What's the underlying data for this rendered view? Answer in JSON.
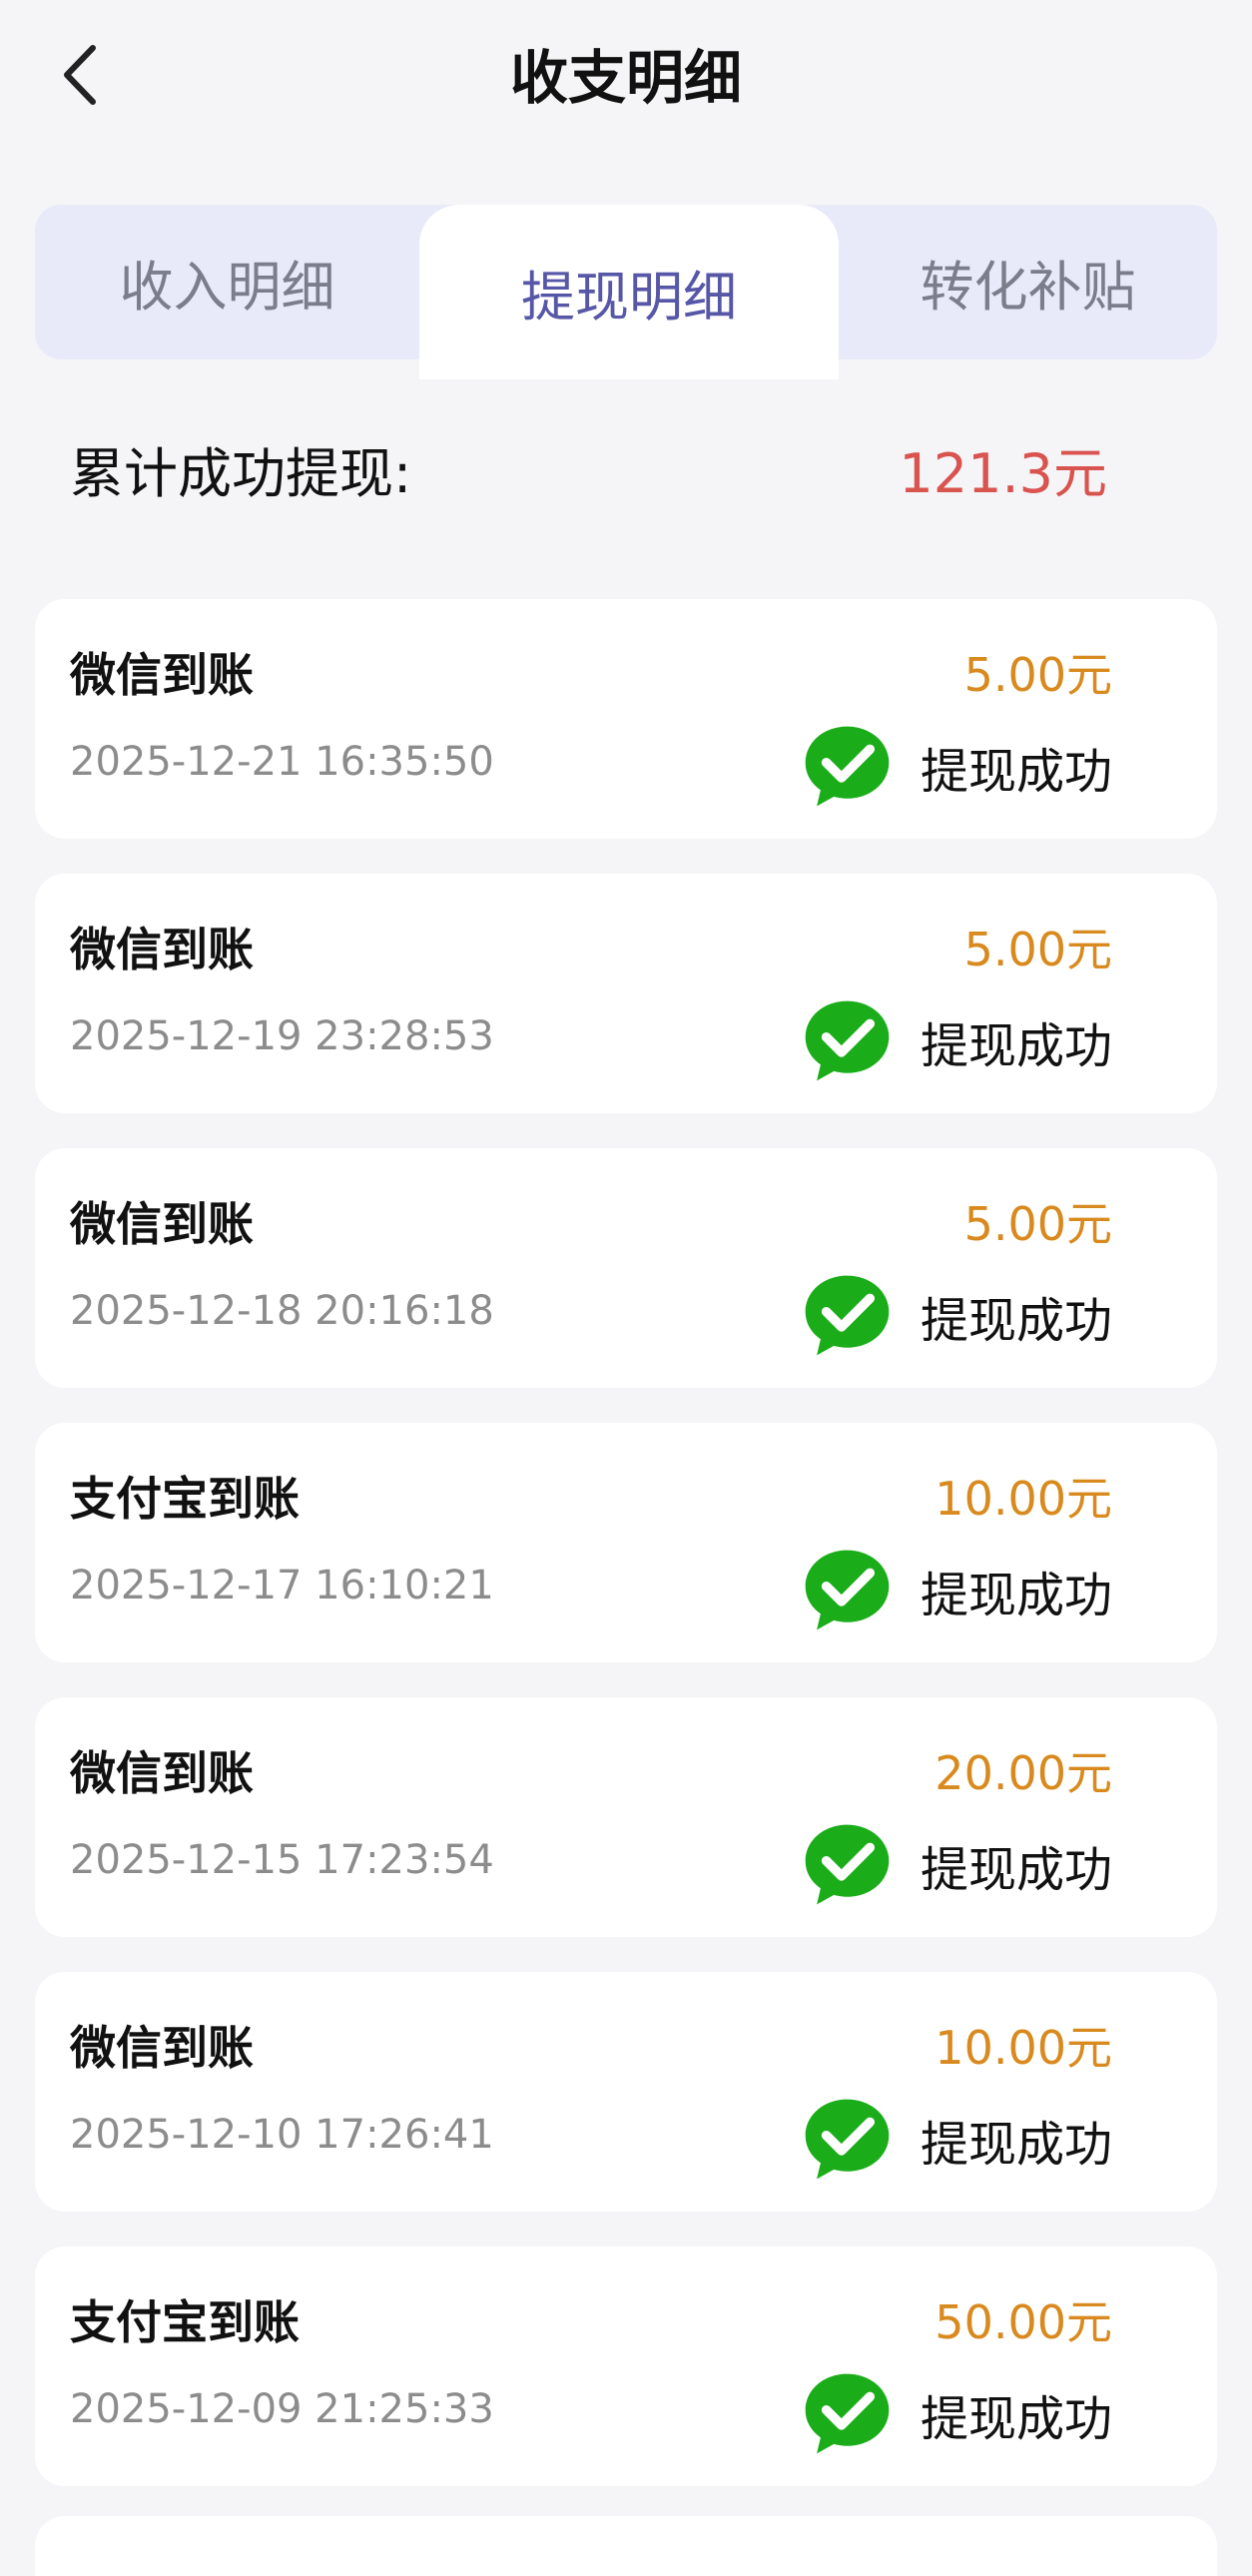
{
  "header": {
    "title": "收支明细"
  },
  "tabs": [
    {
      "label": "收入明细"
    },
    {
      "label": "提现明细"
    },
    {
      "label": "转化补贴"
    }
  ],
  "summary": {
    "label": "累计成功提现:",
    "value": "121.3元"
  },
  "records": [
    {
      "title": "微信到账",
      "time": "2025-12-21 16:35:50",
      "amount": "5.00元",
      "status": "提现成功"
    },
    {
      "title": "微信到账",
      "time": "2025-12-19 23:28:53",
      "amount": "5.00元",
      "status": "提现成功"
    },
    {
      "title": "微信到账",
      "time": "2025-12-18 20:16:18",
      "amount": "5.00元",
      "status": "提现成功"
    },
    {
      "title": "支付宝到账",
      "time": "2025-12-17 16:10:21",
      "amount": "10.00元",
      "status": "提现成功"
    },
    {
      "title": "微信到账",
      "time": "2025-12-15 17:23:54",
      "amount": "20.00元",
      "status": "提现成功"
    },
    {
      "title": "微信到账",
      "time": "2025-12-10 17:26:41",
      "amount": "10.00元",
      "status": "提现成功"
    },
    {
      "title": "支付宝到账",
      "time": "2025-12-09 21:25:33",
      "amount": "50.00元",
      "status": "提现成功"
    }
  ],
  "colors": {
    "accent_tab": "#5757a8",
    "summary_value": "#d9534f",
    "amount": "#d88a1e",
    "success_icon": "#1aad19"
  }
}
